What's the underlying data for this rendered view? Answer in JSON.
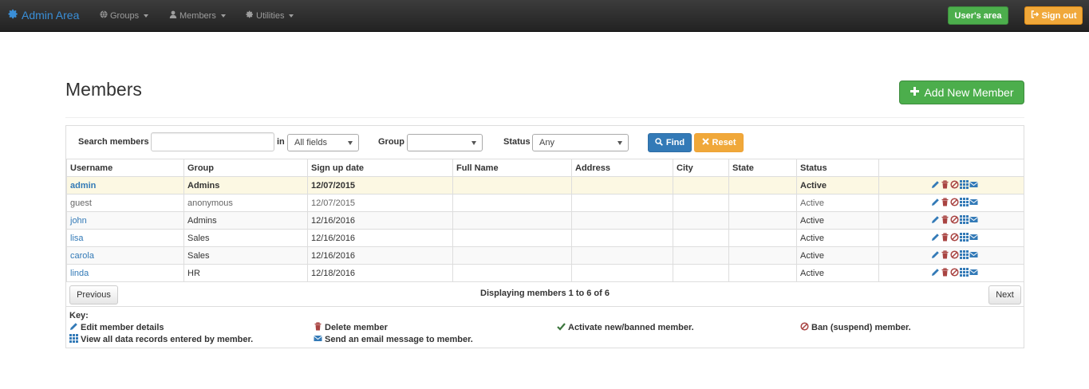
{
  "navbar": {
    "brand": "Admin Area",
    "menus": [
      "Groups",
      "Members",
      "Utilities"
    ],
    "users_area": "User's area",
    "sign_out": "Sign out"
  },
  "page": {
    "title": "Members",
    "add_button": "Add New Member"
  },
  "search": {
    "search_label": "Search members",
    "search_value": "",
    "in_label": "in",
    "in_field": "All fields",
    "group_label": "Group",
    "group_value": "",
    "status_label": "Status",
    "status_value": "Any",
    "find": "Find",
    "reset": "Reset"
  },
  "table": {
    "columns": [
      "Username",
      "Group",
      "Sign up date",
      "Full Name",
      "Address",
      "City",
      "State",
      "Status",
      ""
    ],
    "rows": [
      {
        "username": "admin",
        "group": "Admins",
        "date": "12/07/2015",
        "full_name": "",
        "address": "",
        "city": "",
        "state": "",
        "status": "Active"
      },
      {
        "username": "guest",
        "group": "anonymous",
        "date": "12/07/2015",
        "full_name": "",
        "address": "",
        "city": "",
        "state": "",
        "status": "Active"
      },
      {
        "username": "john",
        "group": "Admins",
        "date": "12/16/2016",
        "full_name": "",
        "address": "",
        "city": "",
        "state": "",
        "status": "Active"
      },
      {
        "username": "lisa",
        "group": "Sales",
        "date": "12/16/2016",
        "full_name": "",
        "address": "",
        "city": "",
        "state": "",
        "status": "Active"
      },
      {
        "username": "carola",
        "group": "Sales",
        "date": "12/16/2016",
        "full_name": "",
        "address": "",
        "city": "",
        "state": "",
        "status": "Active"
      },
      {
        "username": "linda",
        "group": "HR",
        "date": "12/18/2016",
        "full_name": "",
        "address": "",
        "city": "",
        "state": "",
        "status": "Active"
      }
    ]
  },
  "pagination": {
    "previous": "Previous",
    "next": "Next",
    "status": "Displaying members 1 to 6 of 6"
  },
  "key": {
    "title": "Key:",
    "edit": "Edit member details",
    "delete": "Delete member",
    "activate": "Activate new/banned member.",
    "ban": "Ban (suspend) member.",
    "records": "View all data records entered by member.",
    "email": "Send an email message to member."
  },
  "colors": {
    "link": "#337ab7",
    "green": "#4cae4c",
    "orange": "#f0a83a",
    "primary": "#2e6da4",
    "danger": "#a94442",
    "highlight_row": "#fcf8e3"
  },
  "icons": {
    "brand": "cog-icon",
    "groups": "globe-icon",
    "members": "user-icon",
    "utilities": "cog-icon",
    "users_area": "none",
    "sign_out": "log-out-icon",
    "add": "plus-icon",
    "find": "search-icon",
    "reset": "remove-icon",
    "row_actions": [
      "pencil-icon",
      "trash-icon",
      "ban-icon",
      "grid-icon",
      "envelope-icon"
    ]
  }
}
